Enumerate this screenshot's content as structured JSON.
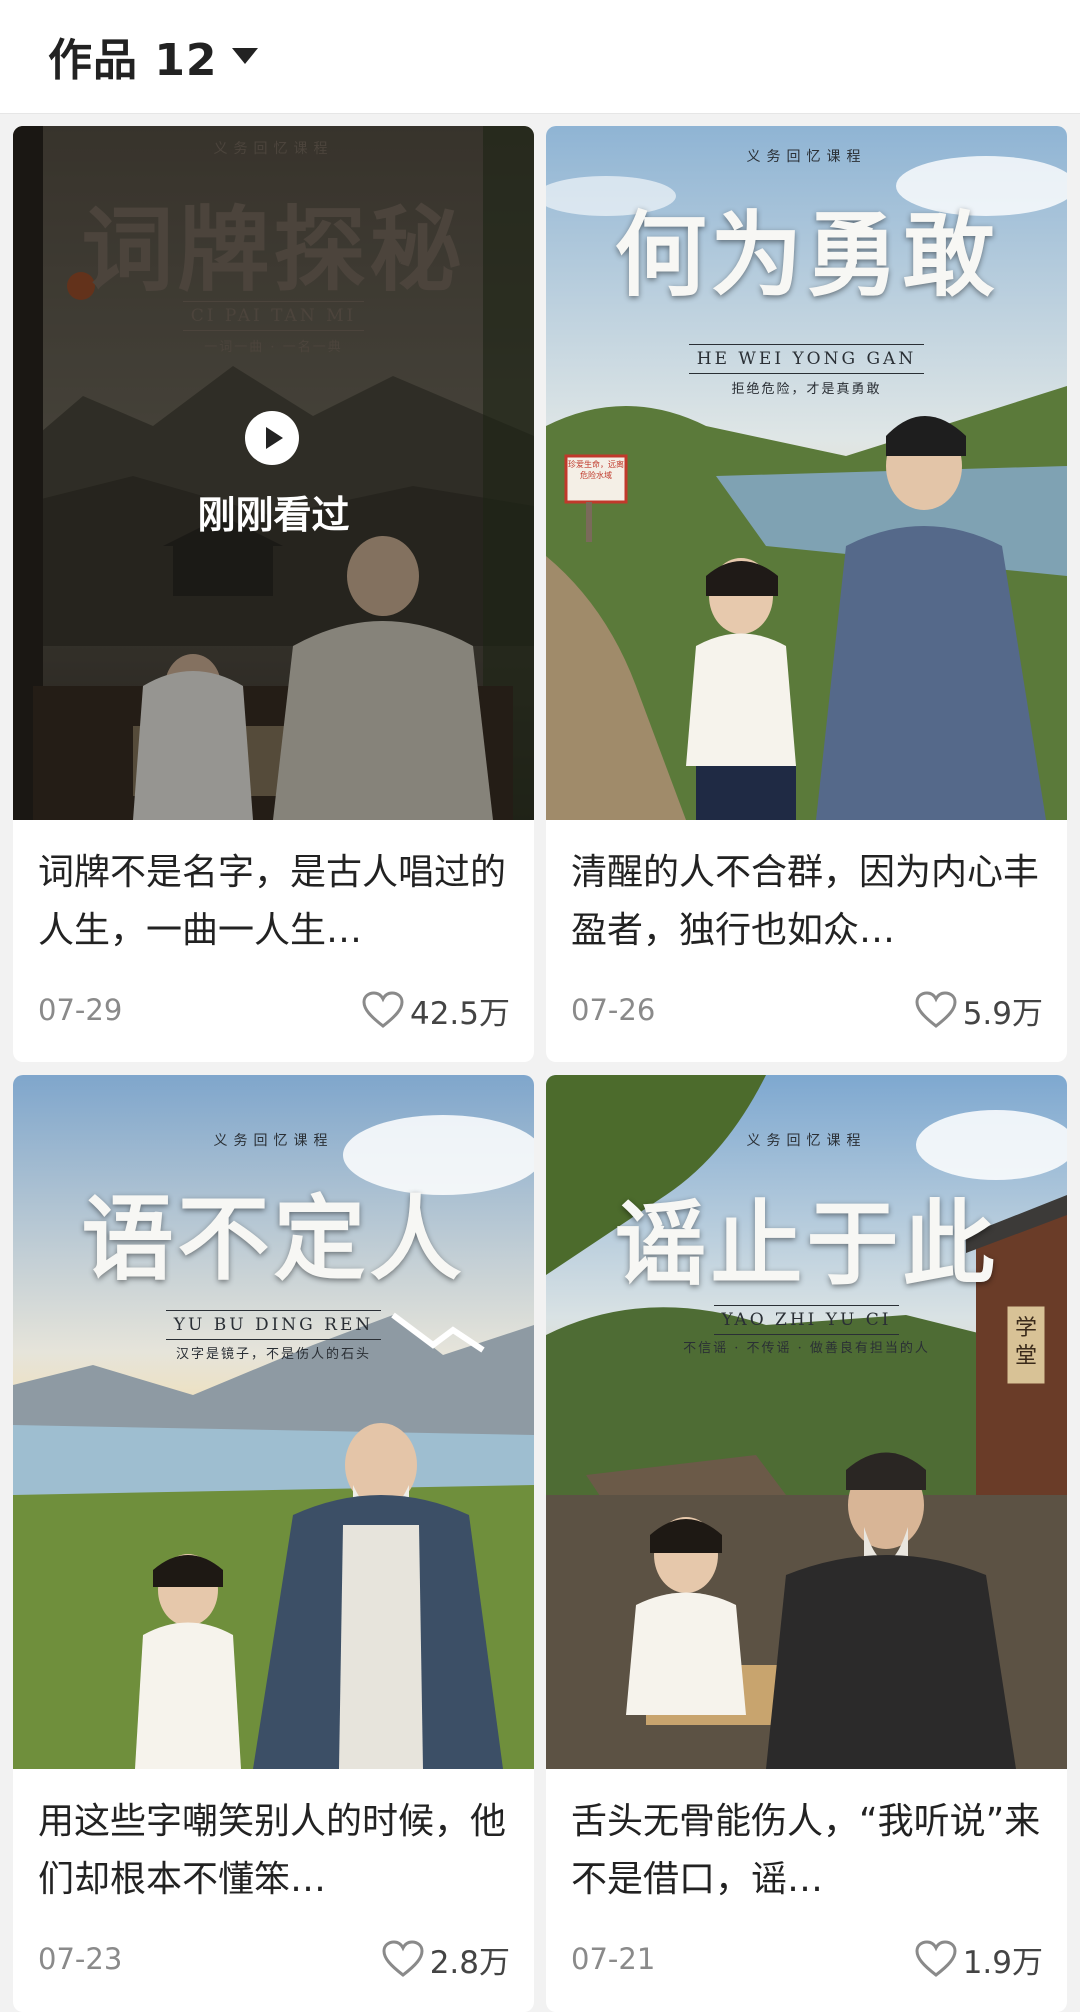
{
  "header": {
    "title": "作品 12"
  },
  "cards": [
    {
      "poster": {
        "series": "义务回忆课程",
        "title": "词牌探秘",
        "pinyin": "CI PAI TAN MI",
        "subtitle": "一词一曲 · 一名一典"
      },
      "watched_label": "刚刚看过",
      "caption": "词牌不是名字，是古人唱过的人生，一曲一人生…",
      "date": "07-29",
      "likes": "42.5万"
    },
    {
      "poster": {
        "series": "义务回忆课程",
        "title": "何为勇敢",
        "pinyin": "HE WEI YONG GAN",
        "subtitle": "拒绝危险，才是真勇敢",
        "sign_text": "珍爱生命，远离危险水域"
      },
      "caption": "清醒的人不合群，因为内心丰盈者，独行也如众…",
      "date": "07-26",
      "likes": "5.9万"
    },
    {
      "poster": {
        "series": "义务回忆课程",
        "title": "语不定人",
        "pinyin": "YU BU DING REN",
        "subtitle": "汉字是镜子，不是伤人的石头"
      },
      "caption": "用这些字嘲笑别人的时候，他们却根本不懂笨…",
      "date": "07-23",
      "likes": "2.8万"
    },
    {
      "poster": {
        "series": "义务回忆课程",
        "title": "谣止于此",
        "pinyin": "YAO ZHI YU CI",
        "subtitle": "不信谣 · 不传谣 · 做善良有担当的人",
        "plaque_text": "学堂"
      },
      "caption": "舌头无骨能伤人，“我听说”来不是借口，谣…",
      "date": "07-21",
      "likes": "1.9万"
    }
  ],
  "icons": {
    "dropdown": "caret-down-icon",
    "play": "play-icon",
    "like": "heart-icon"
  }
}
